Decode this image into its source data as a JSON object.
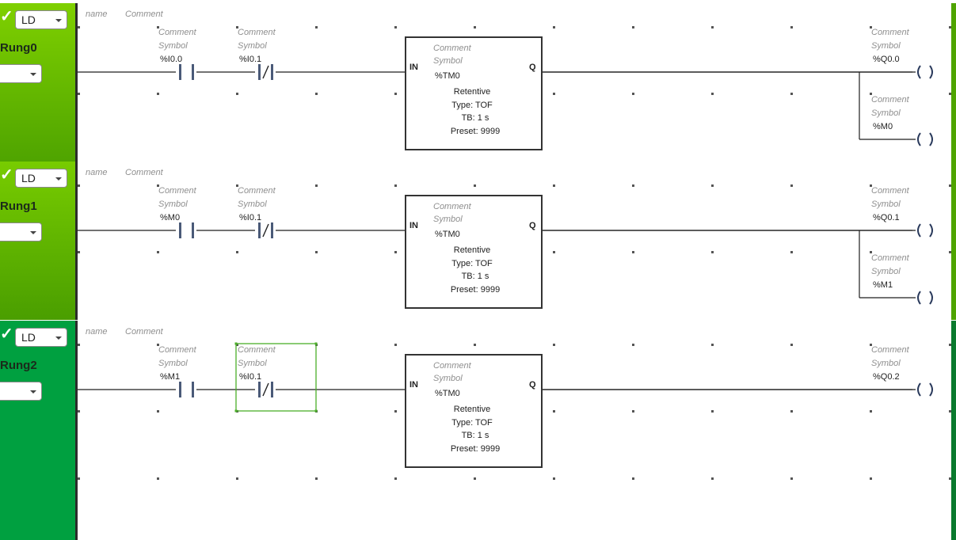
{
  "rungs": [
    {
      "label": "Rung0",
      "language": "LD",
      "header": {
        "name": "name",
        "comment": "Comment"
      },
      "contacts": [
        {
          "comment": "Comment",
          "symbol": "Symbol",
          "address": "%I0.0",
          "type": "normally-open"
        },
        {
          "comment": "Comment",
          "symbol": "Symbol",
          "address": "%I0.1",
          "type": "normally-closed"
        }
      ],
      "timer": {
        "comment": "Comment",
        "symbol": "Symbol",
        "address": "%TM0",
        "in_label": "IN",
        "q_label": "Q",
        "retentive": "Retentive",
        "type": "Type: TOF",
        "tb": "TB: 1 s",
        "preset": "Preset: 9999"
      },
      "coils": [
        {
          "comment": "Comment",
          "symbol": "Symbol",
          "address": "%Q0.0"
        },
        {
          "comment": "Comment",
          "symbol": "Symbol",
          "address": "%M0"
        }
      ]
    },
    {
      "label": "Rung1",
      "language": "LD",
      "header": {
        "name": "name",
        "comment": "Comment"
      },
      "contacts": [
        {
          "comment": "Comment",
          "symbol": "Symbol",
          "address": "%M0",
          "type": "normally-open"
        },
        {
          "comment": "Comment",
          "symbol": "Symbol",
          "address": "%I0.1",
          "type": "normally-closed"
        }
      ],
      "timer": {
        "comment": "Comment",
        "symbol": "Symbol",
        "address": "%TM0",
        "in_label": "IN",
        "q_label": "Q",
        "retentive": "Retentive",
        "type": "Type: TOF",
        "tb": "TB: 1 s",
        "preset": "Preset: 9999"
      },
      "coils": [
        {
          "comment": "Comment",
          "symbol": "Symbol",
          "address": "%Q0.1"
        },
        {
          "comment": "Comment",
          "symbol": "Symbol",
          "address": "%M1"
        }
      ]
    },
    {
      "label": "Rung2",
      "language": "LD",
      "header": {
        "name": "name",
        "comment": "Comment"
      },
      "contacts": [
        {
          "comment": "Comment",
          "symbol": "Symbol",
          "address": "%M1",
          "type": "normally-open"
        },
        {
          "comment": "Comment",
          "symbol": "Symbol",
          "address": "%I0.1",
          "type": "normally-closed",
          "selected": true
        }
      ],
      "timer": {
        "comment": "Comment",
        "symbol": "Symbol",
        "address": "%TM0",
        "in_label": "IN",
        "q_label": "Q",
        "retentive": "Retentive",
        "type": "Type: TOF",
        "tb": "TB: 1 s",
        "preset": "Preset: 9999"
      },
      "coils": [
        {
          "comment": "Comment",
          "symbol": "Symbol",
          "address": "%Q0.2"
        }
      ]
    }
  ],
  "colors": {
    "rung_side_light": "#6cc000",
    "rung_side_active": "#009c3a",
    "selection": "#4caf2a",
    "wire": "#1e1e1e"
  }
}
